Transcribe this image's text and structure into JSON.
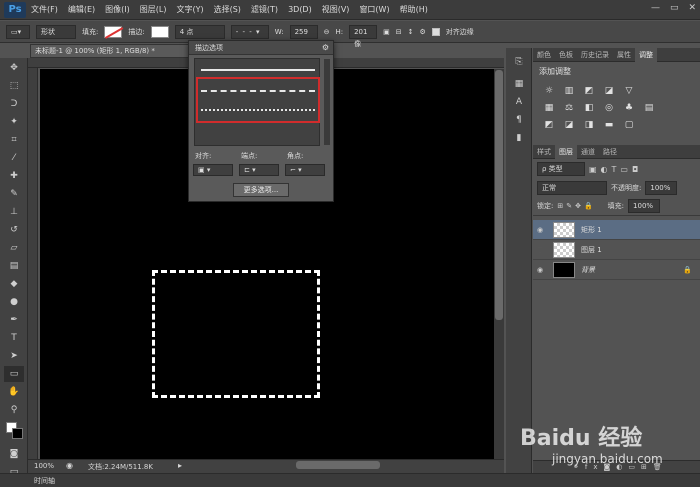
{
  "app": {
    "logo": "Ps"
  },
  "menu": [
    "文件(F)",
    "编辑(E)",
    "图像(I)",
    "图层(L)",
    "文字(Y)",
    "选择(S)",
    "滤镜(T)",
    "3D(D)",
    "视图(V)",
    "窗口(W)",
    "帮助(H)"
  ],
  "window_controls": [
    "—",
    "▭",
    "✕"
  ],
  "options_bar": {
    "shape_mode": "形状",
    "fill_label": "填充:",
    "stroke_label": "描边:",
    "stroke_width": "4 点",
    "w_label": "W:",
    "w_value": "259 像",
    "h_label": "H:",
    "h_value": "201 像",
    "align_edges_label": "对齐边缘"
  },
  "document_tab": "未标题-1 @ 100% (矩形 1, RGB/8) *",
  "stroke_popup": {
    "title": "描边选项",
    "align_label": "对齐:",
    "caps_label": "端点:",
    "corners_label": "角点:",
    "more_options_label": "更多选项..."
  },
  "status": {
    "zoom": "100%",
    "doc_info": "文档:2.24M/511.8K",
    "timeline_label": "时间轴"
  },
  "right_panel": {
    "top_tabs": [
      "颜色",
      "色板",
      "历史记录",
      "属性",
      "调整"
    ],
    "adjust_title": "添加调整",
    "layer_tabs": [
      "样式",
      "图层",
      "通道",
      "路径"
    ],
    "kind_filter": "ρ 类型",
    "blend_mode": "正常",
    "opacity_label": "不透明度:",
    "opacity_value": "100%",
    "lock_label": "锁定:",
    "fill_label": "填充:",
    "fill_value": "100%",
    "layers": [
      {
        "name": "矩形 1",
        "thumb": "transparent",
        "visible": true,
        "selected": true
      },
      {
        "name": "图层 1",
        "thumb": "transparent",
        "visible": false,
        "selected": false
      },
      {
        "name": "背景",
        "thumb": "black",
        "visible": true,
        "selected": false
      }
    ]
  },
  "watermark": {
    "brand": "Baidu 经验",
    "url": "jingyan.baidu.com"
  },
  "colors": {
    "highlight": "#d12c2c",
    "selected_layer": "#5b6d84",
    "canvas": "#000000"
  }
}
